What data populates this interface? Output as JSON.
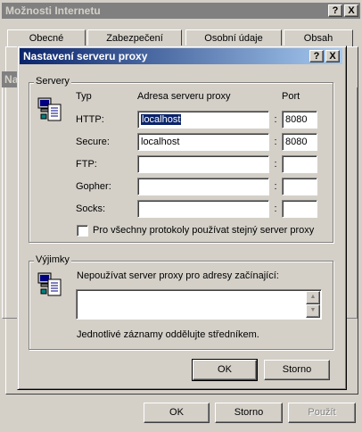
{
  "back_window": {
    "title": "Možnosti Internetu",
    "title_help": "?",
    "title_close": "X",
    "tabs": [
      "Obecné",
      "Zabezpečení",
      "Osobní údaje",
      "Obsah"
    ],
    "partial_label": "Na",
    "ok_label": "OK",
    "cancel_label": "Storno",
    "apply_label": "Použít"
  },
  "dialog": {
    "title": "Nastavení serveru proxy",
    "title_help": "?",
    "title_close": "X",
    "servers_group": "Servery",
    "col_type": "Typ",
    "col_address": "Adresa serveru proxy",
    "col_port": "Port",
    "rows": [
      {
        "type": "HTTP:",
        "address": "localhost",
        "port": "8080",
        "selected": true
      },
      {
        "type": "Secure:",
        "address": "localhost",
        "port": "8080",
        "selected": false
      },
      {
        "type": "FTP:",
        "address": "",
        "port": "",
        "selected": false
      },
      {
        "type": "Gopher:",
        "address": "",
        "port": "",
        "selected": false
      },
      {
        "type": "Socks:",
        "address": "",
        "port": "",
        "selected": false
      }
    ],
    "same_proxy_label": "Pro všechny protokoly používat stejný server proxy",
    "same_proxy_checked": false,
    "exceptions_group": "Výjimky",
    "exceptions_label": "Nepoužívat server proxy pro adresy začínající:",
    "exceptions_value": "",
    "exceptions_hint": "Jednotlivé záznamy oddělujte středníkem.",
    "ok_label": "OK",
    "cancel_label": "Storno"
  },
  "colors": {
    "active_title_start": "#0a246a",
    "active_title_end": "#a6caf0",
    "inactive_title": "#808080",
    "face": "#d4d0c8"
  }
}
